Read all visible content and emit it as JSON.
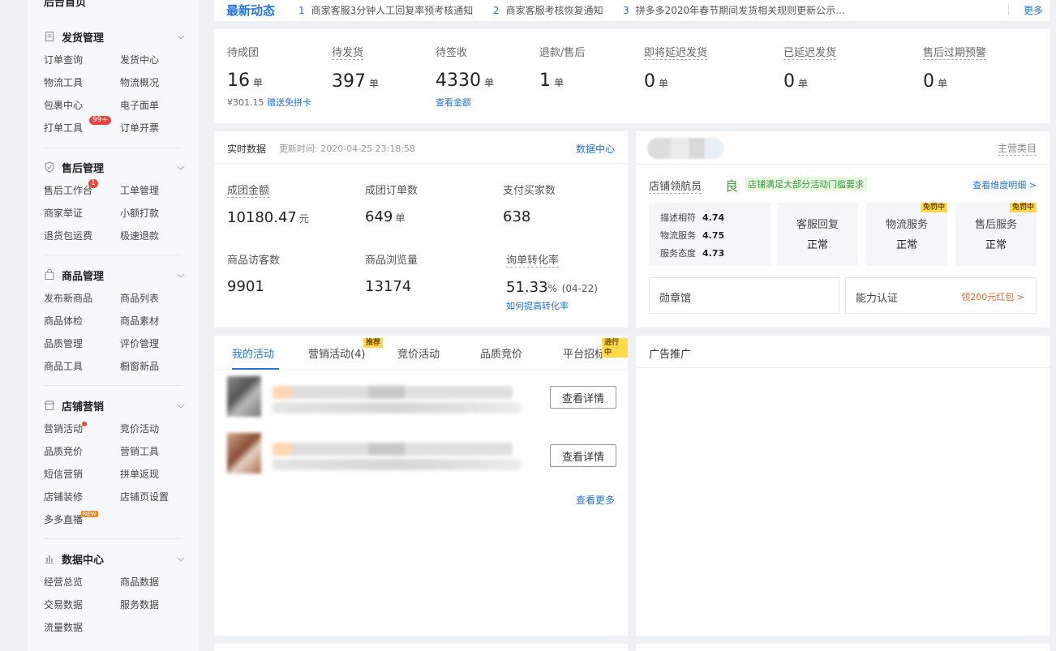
{
  "sidebar": {
    "top_label": "后台首页",
    "sections": [
      {
        "title": "发货管理",
        "icon": "document-icon",
        "items": [
          "订单查询",
          "发货中心",
          "物流工具",
          "物流概况",
          "包裹中心",
          "电子面单",
          "打单工具",
          "订单开票"
        ],
        "badge": "99+"
      },
      {
        "title": "售后管理",
        "icon": "shield-check-icon",
        "items": [
          "售后工作台",
          "工单管理",
          "商家举证",
          "小额打款",
          "退货包运费",
          "极速退款"
        ],
        "badge": "1"
      },
      {
        "title": "商品管理",
        "icon": "bag-icon",
        "items": [
          "发布新商品",
          "商品列表",
          "商品体检",
          "商品素材",
          "品质管理",
          "评价管理",
          "商品工具",
          "橱窗新品"
        ]
      },
      {
        "title": "店铺营销",
        "icon": "store-icon",
        "items": [
          "营销活动",
          "竞价活动",
          "品质竞价",
          "营销工具",
          "短信营销",
          "拼单返现",
          "店铺装修",
          "店铺页设置",
          "多多直播"
        ],
        "new_badge": "NEW"
      },
      {
        "title": "数据中心",
        "icon": "bar-chart-icon",
        "items": [
          "经营总览",
          "商品数据",
          "交易数据",
          "服务数据",
          "流量数据"
        ]
      }
    ]
  },
  "news": {
    "title": "最新动态",
    "items": [
      {
        "num": "1",
        "text": "商家客服3分钟人工回复率预考核通知"
      },
      {
        "num": "2",
        "text": "商家客服考核恢复通知"
      },
      {
        "num": "3",
        "text": "拼多多2020年春节期间发货相关规则更新公示..."
      }
    ],
    "more": "更多"
  },
  "orders": [
    {
      "label": "待成团",
      "value": "16",
      "unit": "单",
      "sub_text": "¥301.15",
      "sub_link": "赠送免拼卡"
    },
    {
      "label": "待发货",
      "value": "397",
      "unit": "单"
    },
    {
      "label": "待签收",
      "value": "4330",
      "unit": "单",
      "sub_link": "查看金额"
    },
    {
      "label": "退款/售后",
      "value": "1",
      "unit": "单"
    },
    {
      "label": "即将延迟发货",
      "value": "0",
      "unit": "单"
    },
    {
      "label": "已延迟发货",
      "value": "0",
      "unit": "单"
    },
    {
      "label": "售后过期预警",
      "value": "0",
      "unit": "单"
    }
  ],
  "realtime": {
    "title": "实时数据",
    "updated": "更新时间: 2020-04-25 23:18:58",
    "link": "数据中心",
    "cells": [
      {
        "label": "成团金额",
        "value": "10180.47",
        "unit": "元"
      },
      {
        "label": "成团订单数",
        "value": "649",
        "unit": "单"
      },
      {
        "label": "支付买家数",
        "value": "638",
        "unit": ""
      },
      {
        "label": "商品访客数",
        "value": "9901",
        "unit": ""
      },
      {
        "label": "商品浏览量",
        "value": "13174",
        "unit": ""
      },
      {
        "label": "询单转化率",
        "value": "51.33",
        "unit": "%",
        "extra": "(04-22)",
        "sub_link": "如何提高转化率"
      }
    ]
  },
  "shop": {
    "main_category": "主营类目",
    "nav_label": "店铺领航员",
    "grade": "良",
    "grade_tip": "店铺满足大部分活动门槛要求",
    "detail_link": "查看维度明细 >",
    "scores": [
      {
        "name": "描述相符",
        "value": "4.74"
      },
      {
        "name": "物流服务",
        "value": "4.75"
      },
      {
        "name": "服务态度",
        "value": "4.73"
      }
    ],
    "boxes": [
      {
        "name": "客服回复",
        "status": "正常",
        "tag": ""
      },
      {
        "name": "物流服务",
        "status": "正常",
        "tag": "免罚中"
      },
      {
        "name": "售后服务",
        "status": "正常",
        "tag": "免罚中"
      }
    ],
    "medal": "勋章馆",
    "ability": "能力认证",
    "ability_link": "领200元红包 >"
  },
  "activities": {
    "tabs": [
      {
        "label": "我的活动",
        "tag": ""
      },
      {
        "label": "营销活动(4)",
        "tag": "推荐"
      },
      {
        "label": "竞价活动",
        "tag": ""
      },
      {
        "label": "品质竞价",
        "tag": ""
      },
      {
        "label": "平台招标",
        "tag": "进行中"
      }
    ],
    "detail_button": "查看详情",
    "more": "查看更多"
  },
  "ads": {
    "title": "广告推广"
  },
  "colors": {
    "accent": "#2573d6",
    "good": "#3aa33a",
    "warn": "#e8692a",
    "badge": "#e8453c",
    "tag": "#ffd94a"
  }
}
